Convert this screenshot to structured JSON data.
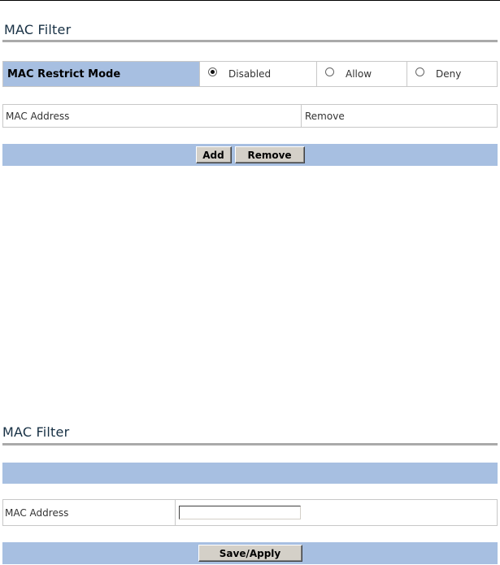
{
  "mac_filter_list": {
    "title": "MAC Filter",
    "restrict_mode": {
      "label": "MAC Restrict Mode",
      "options": [
        {
          "label": "Disabled",
          "checked": true
        },
        {
          "label": "Allow",
          "checked": false
        },
        {
          "label": "Deny",
          "checked": false
        }
      ]
    },
    "table": {
      "columns": [
        "MAC Address",
        "Remove"
      ]
    },
    "buttons": {
      "add": "Add",
      "remove": "Remove"
    }
  },
  "mac_filter_add": {
    "title": "MAC Filter",
    "field_label": "MAC Address",
    "field_value": "",
    "save_apply": "Save/Apply"
  },
  "colors": {
    "header_blue": "#a7bfe1",
    "title_text": "#173044",
    "rule_gray": "#aaaaaa"
  }
}
